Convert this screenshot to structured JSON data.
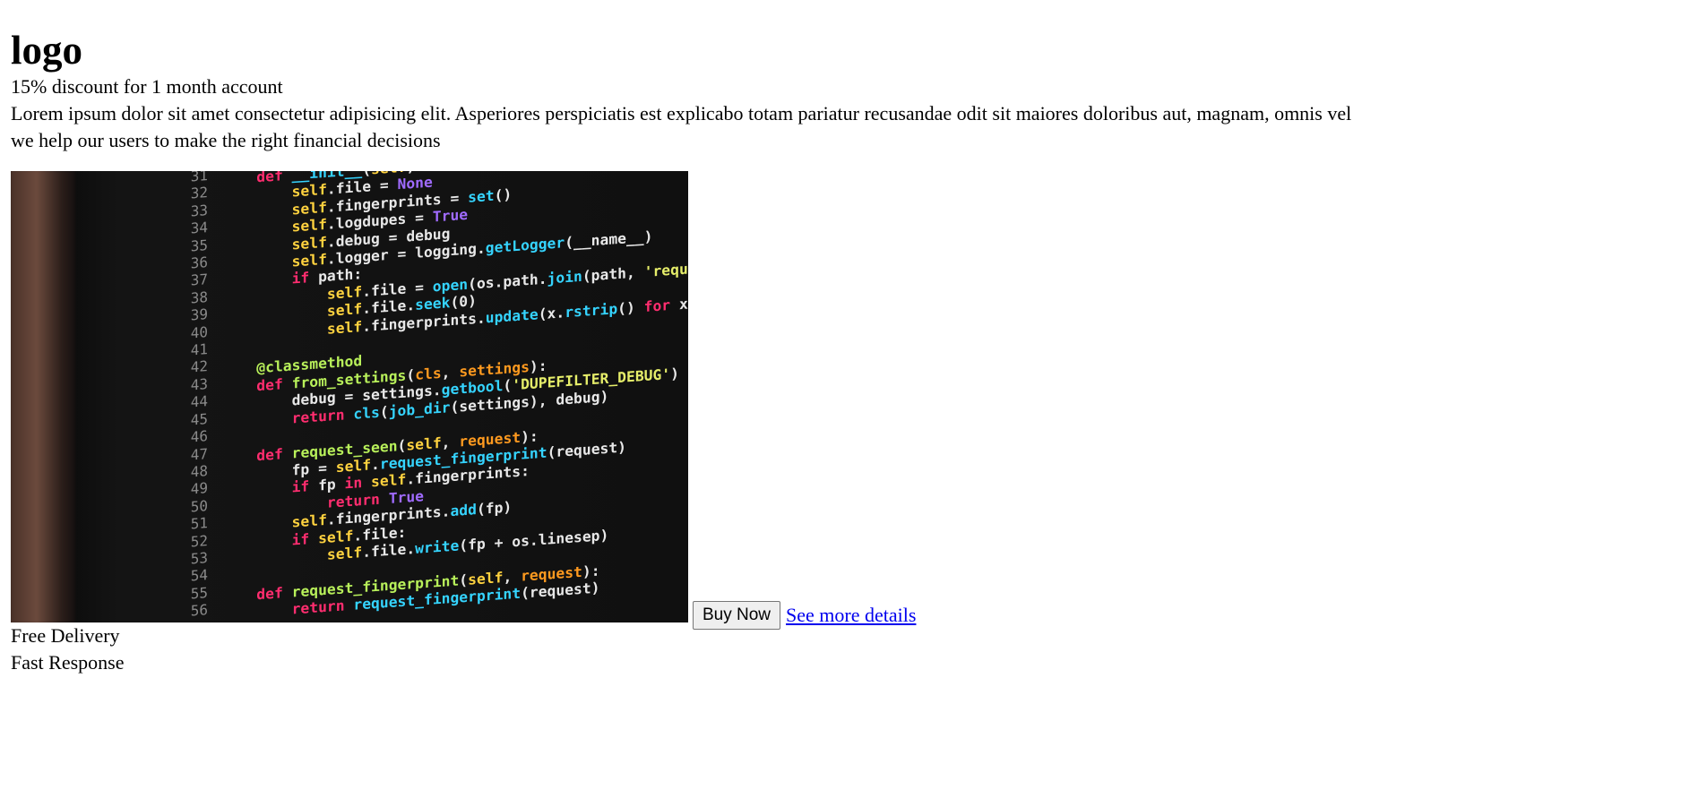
{
  "header": {
    "logo": "logo"
  },
  "content": {
    "discount": "15% discount for 1 month account",
    "description": "Lorem ipsum dolor sit amet consectetur adipisicing elit. Asperiores perspiciatis est explicabo totam pariatur recusandae odit sit maiores doloribus aut, magnam, omnis vel",
    "tagline": "we help our users to make the right financial decisions"
  },
  "actions": {
    "buy_label": "Buy Now",
    "details_label": "See more details"
  },
  "features": [
    {
      "label": "Free Delivery"
    },
    {
      "label": "Fast Response"
    }
  ],
  "image": {
    "line_numbers": [
      "31",
      "32",
      "33",
      "34",
      "35",
      "36",
      "37",
      "38",
      "39",
      "40",
      "41",
      "42",
      "43",
      "44",
      "45",
      "46",
      "47",
      "48",
      "49",
      "50",
      "51",
      "52",
      "53",
      "54",
      "55",
      "56"
    ]
  }
}
